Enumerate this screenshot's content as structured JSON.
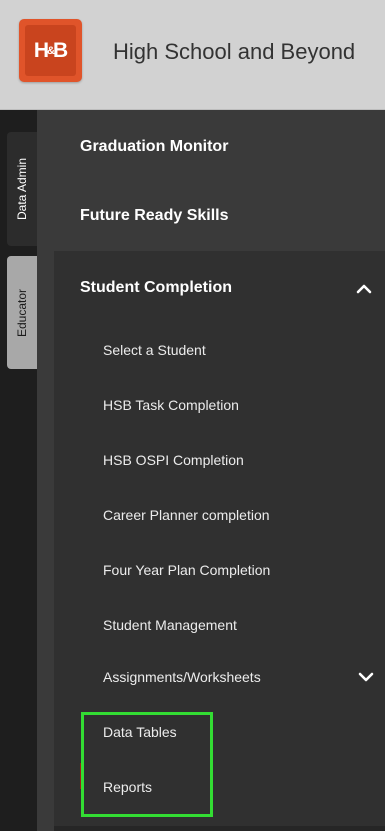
{
  "header": {
    "logo_text": "H&B",
    "title": "High School and Beyond"
  },
  "rail": {
    "tabs": [
      {
        "label": "Data Admin",
        "active": false
      },
      {
        "label": "Educator",
        "active": true
      }
    ]
  },
  "nav": {
    "items": [
      {
        "label": "Graduation Monitor"
      },
      {
        "label": "Future Ready Skills"
      },
      {
        "label": "Student Completion",
        "expanded": true
      }
    ],
    "student_completion_sub": [
      {
        "label": "Select a Student"
      },
      {
        "label": "HSB Task Completion"
      },
      {
        "label": "HSB OSPI Completion"
      },
      {
        "label": "Career Planner completion"
      },
      {
        "label": "Four Year Plan Completion"
      },
      {
        "label": "Student Management"
      },
      {
        "label": "Assignments/Worksheets",
        "expandable": true
      },
      {
        "label": "Data Tables"
      },
      {
        "label": "Reports"
      }
    ]
  },
  "colors": {
    "header_bg": "#d2d2d2",
    "logo_orange": "#e0542a",
    "nav_bg": "#3a3a3a",
    "section_bg": "#303030",
    "rail_bg": "#1e1e1e",
    "active_tab": "#a8a8a8",
    "highlight_green": "#33dd33"
  },
  "icons": {
    "collapse": "chevron-up-icon",
    "expand": "chevron-down-icon"
  }
}
